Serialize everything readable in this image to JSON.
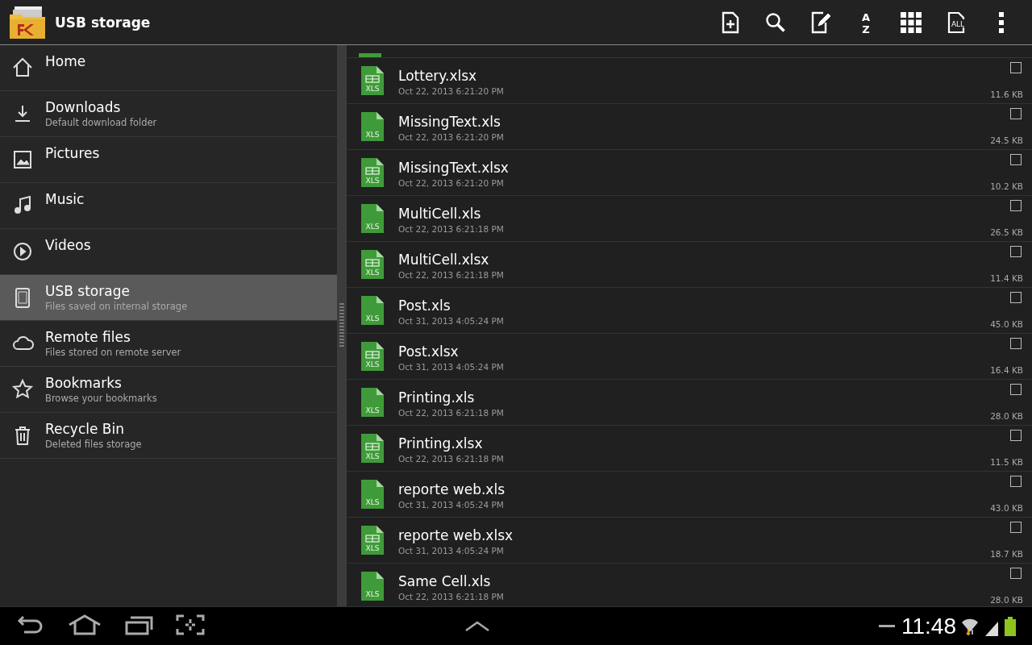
{
  "action_bar": {
    "title": "USB storage",
    "sort_icon_letters": [
      "A",
      "Z"
    ],
    "select_all_label": "ALL"
  },
  "sidebar": {
    "items": [
      {
        "kind": "home",
        "label": "Home",
        "selected": false
      },
      {
        "kind": "download",
        "label": "Downloads",
        "subtitle": "Default download folder",
        "selected": false
      },
      {
        "kind": "picture",
        "label": "Pictures",
        "selected": false
      },
      {
        "kind": "music",
        "label": "Music",
        "selected": false
      },
      {
        "kind": "video",
        "label": "Videos",
        "selected": false
      },
      {
        "kind": "tablet",
        "label": "USB storage",
        "subtitle": "Files saved on internal storage",
        "selected": true
      },
      {
        "kind": "cloud",
        "label": "Remote files",
        "subtitle": "Files stored on remote server",
        "selected": false
      },
      {
        "kind": "star",
        "label": "Bookmarks",
        "subtitle": "Browse your bookmarks",
        "selected": false
      },
      {
        "kind": "trash",
        "label": "Recycle Bin",
        "subtitle": "Deleted files storage",
        "selected": false
      }
    ]
  },
  "files": {
    "items": [
      {
        "kind": "xlsx",
        "type_label": "XLS",
        "name": "Lottery.xlsx",
        "date": "Oct 22, 2013 6:21:20 PM",
        "size": "11.6 KB",
        "checked": false
      },
      {
        "kind": "xls",
        "type_label": "XLS",
        "name": "MissingText.xls",
        "date": "Oct 22, 2013 6:21:20 PM",
        "size": "24.5 KB",
        "checked": false
      },
      {
        "kind": "xlsx",
        "type_label": "XLS",
        "name": "MissingText.xlsx",
        "date": "Oct 22, 2013 6:21:20 PM",
        "size": "10.2 KB",
        "checked": false
      },
      {
        "kind": "xls",
        "type_label": "XLS",
        "name": "MultiCell.xls",
        "date": "Oct 22, 2013 6:21:18 PM",
        "size": "26.5 KB",
        "checked": false
      },
      {
        "kind": "xlsx",
        "type_label": "XLS",
        "name": "MultiCell.xlsx",
        "date": "Oct 22, 2013 6:21:18 PM",
        "size": "11.4 KB",
        "checked": false
      },
      {
        "kind": "xls",
        "type_label": "XLS",
        "name": "Post.xls",
        "date": "Oct 31, 2013 4:05:24 PM",
        "size": "45.0 KB",
        "checked": false
      },
      {
        "kind": "xlsx",
        "type_label": "XLS",
        "name": "Post.xlsx",
        "date": "Oct 31, 2013 4:05:24 PM",
        "size": "16.4 KB",
        "checked": false
      },
      {
        "kind": "xls",
        "type_label": "XLS",
        "name": "Printing.xls",
        "date": "Oct 22, 2013 6:21:18 PM",
        "size": "28.0 KB",
        "checked": false
      },
      {
        "kind": "xlsx",
        "type_label": "XLS",
        "name": "Printing.xlsx",
        "date": "Oct 22, 2013 6:21:18 PM",
        "size": "11.5 KB",
        "checked": false
      },
      {
        "kind": "xls",
        "type_label": "XLS",
        "name": "reporte web.xls",
        "date": "Oct 31, 2013 4:05:24 PM",
        "size": "43.0 KB",
        "checked": false
      },
      {
        "kind": "xlsx",
        "type_label": "XLS",
        "name": "reporte web.xlsx",
        "date": "Oct 31, 2013 4:05:24 PM",
        "size": "18.7 KB",
        "checked": false
      },
      {
        "kind": "xls",
        "type_label": "XLS",
        "name": "Same Cell.xls",
        "date": "Oct 22, 2013 6:21:18 PM",
        "size": "28.0 KB",
        "checked": false
      }
    ]
  },
  "system_bar": {
    "time": "11:48"
  }
}
